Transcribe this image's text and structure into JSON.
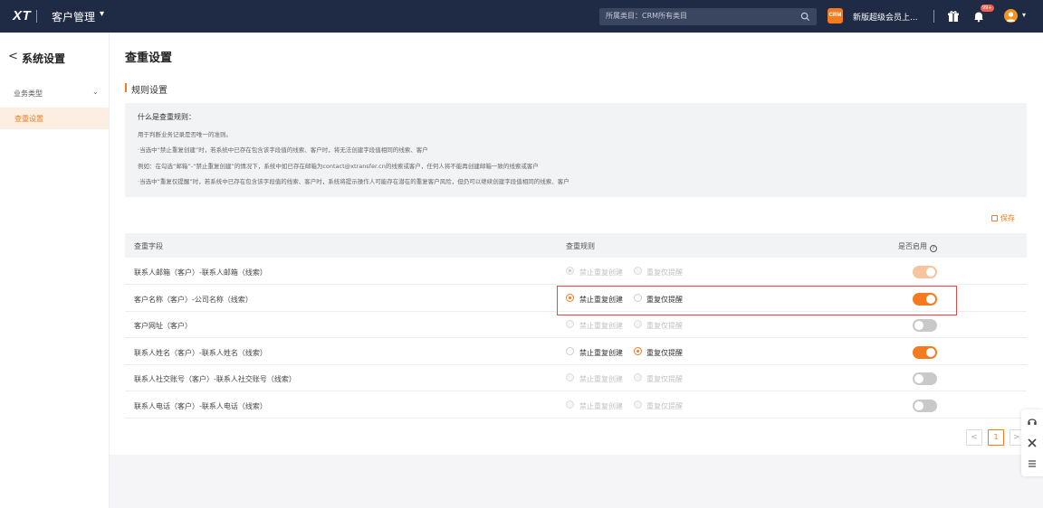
{
  "topbar": {
    "logo": "XT",
    "app_title": "客户管理",
    "search_placeholder": "所属类目：CRM所有类目",
    "crm_badge": "CRM",
    "promo_text": "新版超级会员上...",
    "notification_count": "99+"
  },
  "sidebar": {
    "back_arrow": "<",
    "title": "系统设置",
    "group_label": "业务类型",
    "active_item": "查重设置"
  },
  "main": {
    "page_title": "查重设置",
    "section_title": "规则设置",
    "info": {
      "heading": "什么是查重规则：",
      "lines": [
        "用于判断业务记录是否唯一的准则。",
        "·当选中“禁止重复创建”时，若系统中已存在包含该字段值的线索、客户时，将无法创建字段值相同的线索、客户",
        "例如：在勾选“邮箱”-“禁止重复创建”的情况下，系统中如已存在邮箱为contact@xtransfer.cn的线索或客户，任何人将不能再创建邮箱一致的线索或客户",
        "·当选中“重复仅提醒”时，若系统中已存在包含该字段值的线索、客户时，系统将提示操作人可能存在潜在的重复客户风险，但仍可以继续创建字段值相同的线索、客户"
      ]
    },
    "save_label": "保存",
    "table": {
      "headers": {
        "field": "查重字段",
        "rule": "查重规则",
        "enabled": "是否启用"
      },
      "option_forbid": "禁止重复创建",
      "option_remind": "重复仅提醒",
      "rows": [
        {
          "field": "联系人邮箱（客户）-联系人邮箱（线索）",
          "rule": "forbid",
          "enabled": true,
          "editable": false
        },
        {
          "field": "客户名称（客户）-公司名称（线索）",
          "rule": "forbid",
          "enabled": true,
          "editable": true
        },
        {
          "field": "客户网址（客户）",
          "rule": "none",
          "enabled": false,
          "editable": false
        },
        {
          "field": "联系人姓名（客户）-联系人姓名（线索）",
          "rule": "remind",
          "enabled": true,
          "editable": true
        },
        {
          "field": "联系人社交账号（客户）-联系人社交账号（线索）",
          "rule": "none",
          "enabled": false,
          "editable": false
        },
        {
          "field": "联系人电话（客户）-联系人电话（线索）",
          "rule": "none",
          "enabled": false,
          "editable": false
        }
      ]
    },
    "pagination": {
      "prev": "<",
      "current_page": "1",
      "next": ">"
    }
  },
  "colors": {
    "accent": "#f47b20",
    "topbar": "#1f2a44",
    "highlight_border": "#e04848"
  },
  "icons": [
    "search-icon",
    "gift-icon",
    "bell-icon",
    "help-icon",
    "save-icon",
    "headset-icon",
    "tools-icon",
    "menu-icon"
  ]
}
